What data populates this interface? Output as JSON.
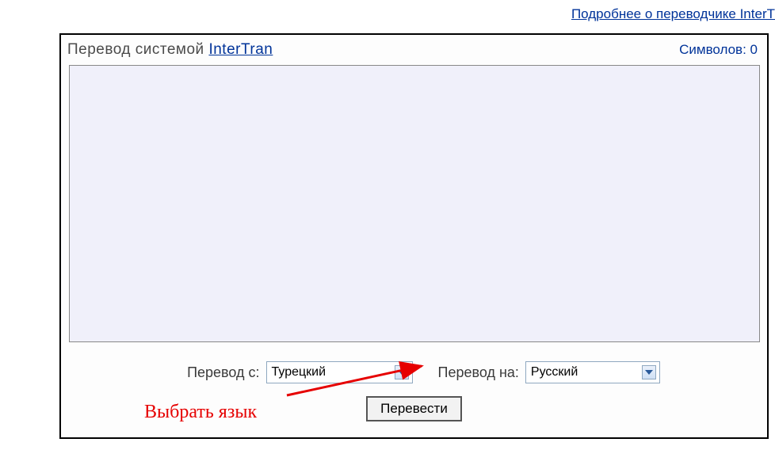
{
  "top_link": "Подробнее о переводчике InterT",
  "panel": {
    "title_prefix": "Перевод системой ",
    "title_link": "InterTran",
    "char_count_label": "Символов: 0"
  },
  "textarea": {
    "value": ""
  },
  "controls": {
    "from_label": "Перевод с:",
    "from_value": "Турецкий",
    "to_label": "Перевод на:",
    "to_value": "Русский"
  },
  "translate_button": "Перевести",
  "annotation": "Выбрать язык"
}
